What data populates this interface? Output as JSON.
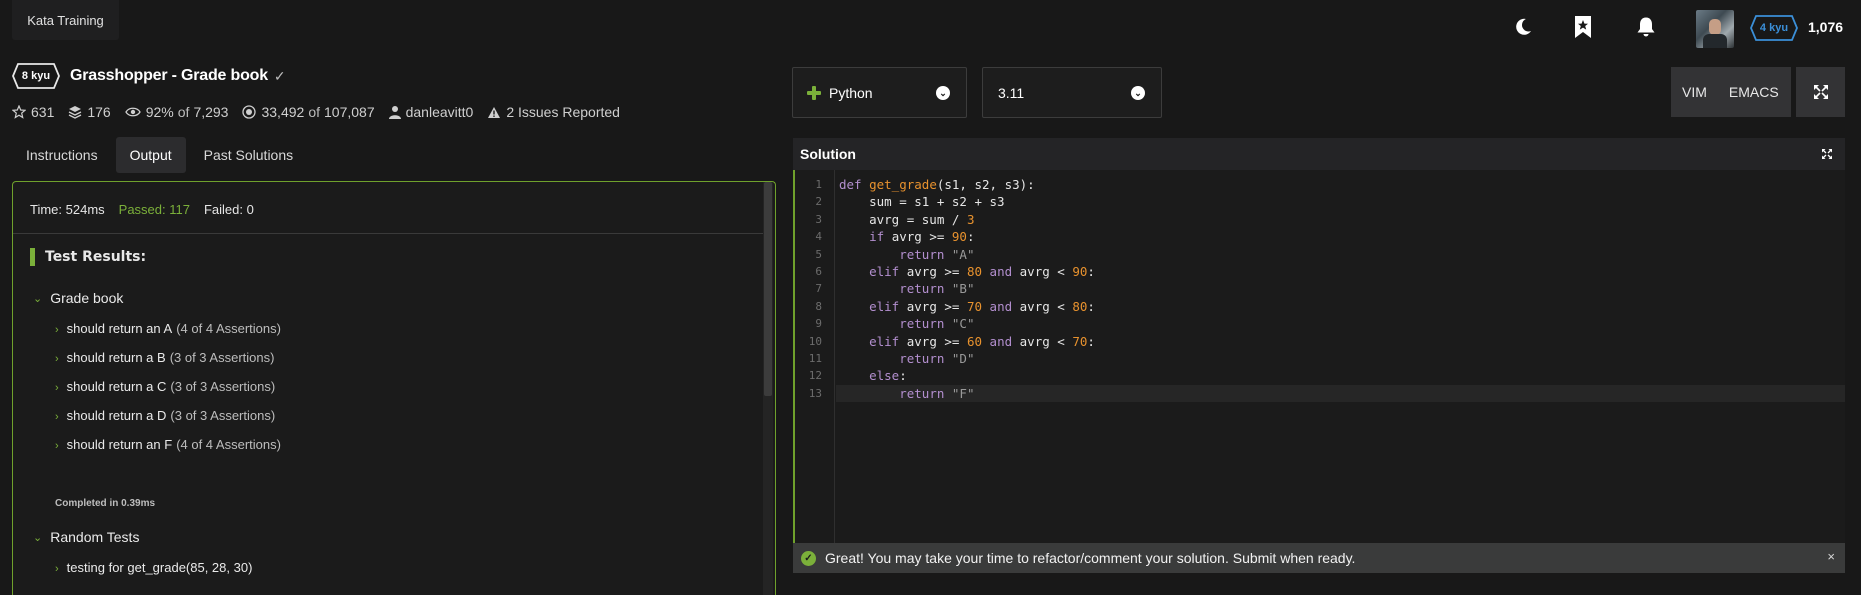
{
  "topbar": {
    "tab_label": "Kata Training",
    "icons": [
      "moon-icon",
      "bookmark-star-icon",
      "bell-icon"
    ],
    "rank": "4 kyu",
    "honor": "1,076"
  },
  "kata": {
    "rank": "8 kyu",
    "title": "Grasshopper - Grade book",
    "stats": {
      "stars": "631",
      "collections": "176",
      "satisfaction": "92%",
      "satisfaction_of": "of",
      "votes": "7,293",
      "completed": "33,492",
      "completed_of": "of",
      "attempts": "107,087",
      "author": "danleavitt0",
      "issues": "2 Issues Reported"
    }
  },
  "tabs": [
    {
      "label": "Instructions"
    },
    {
      "label": "Output"
    },
    {
      "label": "Past Solutions"
    }
  ],
  "output": {
    "time": "Time: 524ms",
    "passed": "Passed: 117",
    "failed": "Failed: 0",
    "results_title": "Test Results:",
    "group1": "Grade book",
    "items": [
      {
        "label": "should return an A",
        "count": "(4 of 4 Assertions)"
      },
      {
        "label": "should return a B",
        "count": "(3 of 3 Assertions)"
      },
      {
        "label": "should return a C",
        "count": "(3 of 3 Assertions)"
      },
      {
        "label": "should return a D",
        "count": "(3 of 3 Assertions)"
      },
      {
        "label": "should return an F",
        "count": "(4 of 4 Assertions)"
      }
    ],
    "completed": "Completed in 0.39ms",
    "group2": "Random Tests",
    "random_item": "testing for get_grade(85, 28, 30)"
  },
  "editor": {
    "language": "Python",
    "version": "3.11",
    "mode_vim": "VIM",
    "mode_emacs": "EMACS",
    "header": "Solution",
    "line_numbers": [
      "1",
      "2",
      "3",
      "4",
      "5",
      "6",
      "7",
      "8",
      "9",
      "10",
      "11",
      "12",
      "13"
    ]
  },
  "notification": {
    "message": "Great! You may take your time to refactor/comment your solution. Submit when ready.",
    "close": "×"
  },
  "colors": {
    "accent_green": "#7bb03a",
    "kyu4_blue": "#3b8fd8",
    "background": "#181818"
  }
}
